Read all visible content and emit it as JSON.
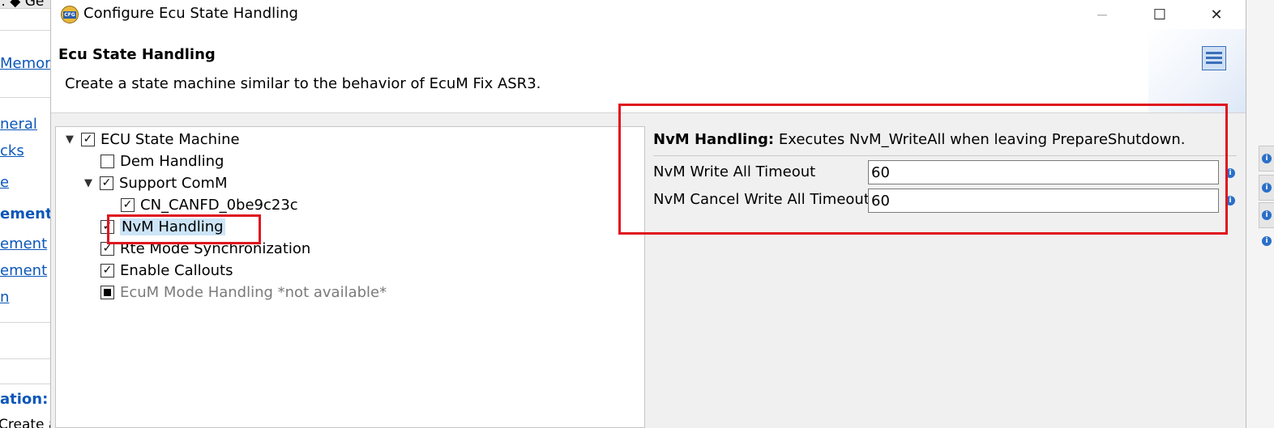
{
  "dialog": {
    "title": "Configure Ecu State Handling",
    "app_icon_text": "CFG",
    "maximize_glyph": "☐",
    "close_glyph": "✕",
    "banner_title": "Ecu State Handling",
    "banner_description": "Create a state machine similar to the behavior of EcuM Fix ASR3."
  },
  "tree": {
    "items": [
      {
        "label": "ECU State Machine",
        "state": "checked",
        "expandable": true
      },
      {
        "label": "Dem Handling",
        "state": "unchecked",
        "expandable": false
      },
      {
        "label": "Support ComM",
        "state": "checked",
        "expandable": true
      },
      {
        "label": "CN_CANFD_0be9c23c",
        "state": "checked",
        "expandable": false
      },
      {
        "label": "NvM Handling",
        "state": "checked",
        "expandable": false,
        "selected": true
      },
      {
        "label": "Rte Mode Synchronization",
        "state": "checked",
        "expandable": false
      },
      {
        "label": "Enable Callouts",
        "state": "checked",
        "expandable": false
      },
      {
        "label": "EcuM Mode Handling *not available*",
        "state": "indeterminate",
        "expandable": false,
        "disabled": true
      }
    ],
    "check_glyph": "✓",
    "expander_glyph": "⌄"
  },
  "details": {
    "header_bold": "NvM Handling:",
    "header_text": " Executes NvM_WriteAll when leaving PrepareShutdown.",
    "fields": [
      {
        "label": "NvM Write All Timeout",
        "value": "60"
      },
      {
        "label": "NvM Cancel Write All Timeout",
        "value": "60"
      }
    ],
    "info_glyph": "i"
  },
  "background_left": {
    "top_fragment": "..  ◆ Ge",
    "links": [
      "Memor",
      "neral",
      "cks",
      "e",
      "ement",
      "ement",
      "ement",
      "n"
    ],
    "bottom_bold": "ation: E",
    "bottom_text": "Create a"
  },
  "colors": {
    "highlight": "#e0141e",
    "link": "#0b57b9",
    "selection": "#cce4f7",
    "panel_bg": "#f0f0f0"
  }
}
